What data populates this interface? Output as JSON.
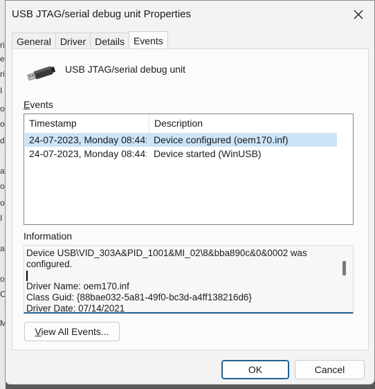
{
  "background_strip": [
    "ri",
    "e",
    "ri",
    "I",
    "o",
    "o",
    "d",
    "a",
    "o",
    "o",
    "I",
    "a",
    "o",
    "C",
    "M"
  ],
  "window": {
    "title": "USB JTAG/serial debug unit Properties"
  },
  "tabs": [
    {
      "label": "General"
    },
    {
      "label": "Driver"
    },
    {
      "label": "Details"
    },
    {
      "label": "Events",
      "active": true
    }
  ],
  "device": {
    "icon": "usb-plug-icon",
    "name": "USB JTAG/serial debug unit"
  },
  "events": {
    "label_prefix": "",
    "label_mnemonic": "E",
    "label_rest": "vents",
    "columns": [
      "Timestamp",
      "Description"
    ],
    "rows": [
      {
        "timestamp": "24-07-2023, Monday 08:44:...",
        "description": "Device configured (oem170.inf)",
        "selected": true
      },
      {
        "timestamp": "24-07-2023, Monday 08:44:...",
        "description": "Device started (WinUSB)",
        "selected": false
      }
    ]
  },
  "information": {
    "label": "Information",
    "lines": [
      "Device USB\\VID_303A&PID_1001&MI_02\\8&bba890c&0&0002 was",
      "configured.",
      "",
      "Driver Name: oem170.inf",
      "Class Guid: {88bae032-5a81-49f0-bc3d-a4ff138216d6}",
      "Driver Date: 07/14/2021"
    ]
  },
  "buttons": {
    "view_all_mnemonic": "V",
    "view_all_rest": "iew All Events...",
    "ok": "OK",
    "cancel": "Cancel"
  },
  "colors": {
    "selection": "#cce4f7",
    "accent": "#1f5f8f"
  }
}
